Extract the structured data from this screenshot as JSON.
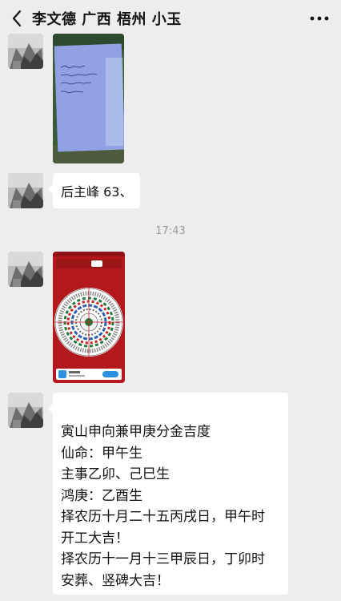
{
  "header": {
    "title": "李文德 广西 梧州 小玉",
    "back_icon": "chevron-left-icon",
    "more_icon": "more-dots-icon"
  },
  "messages": {
    "text1": "后主峰 63、",
    "timestamp": "17:43",
    "text2_lines": [
      "寅山申向兼甲庚分金吉度",
      "仙命：甲午生",
      "主事乙卯、己巳生",
      "鸿庚：乙酉生",
      "择农历十月二十五丙戌日，甲午时",
      "开工大吉！",
      "择农历十一月十三甲辰日，丁卯时",
      "安葬、竖碑大吉！"
    ]
  },
  "colors": {
    "background": "#ededed",
    "bubble": "#ffffff",
    "compass_red": "#b3191c"
  }
}
